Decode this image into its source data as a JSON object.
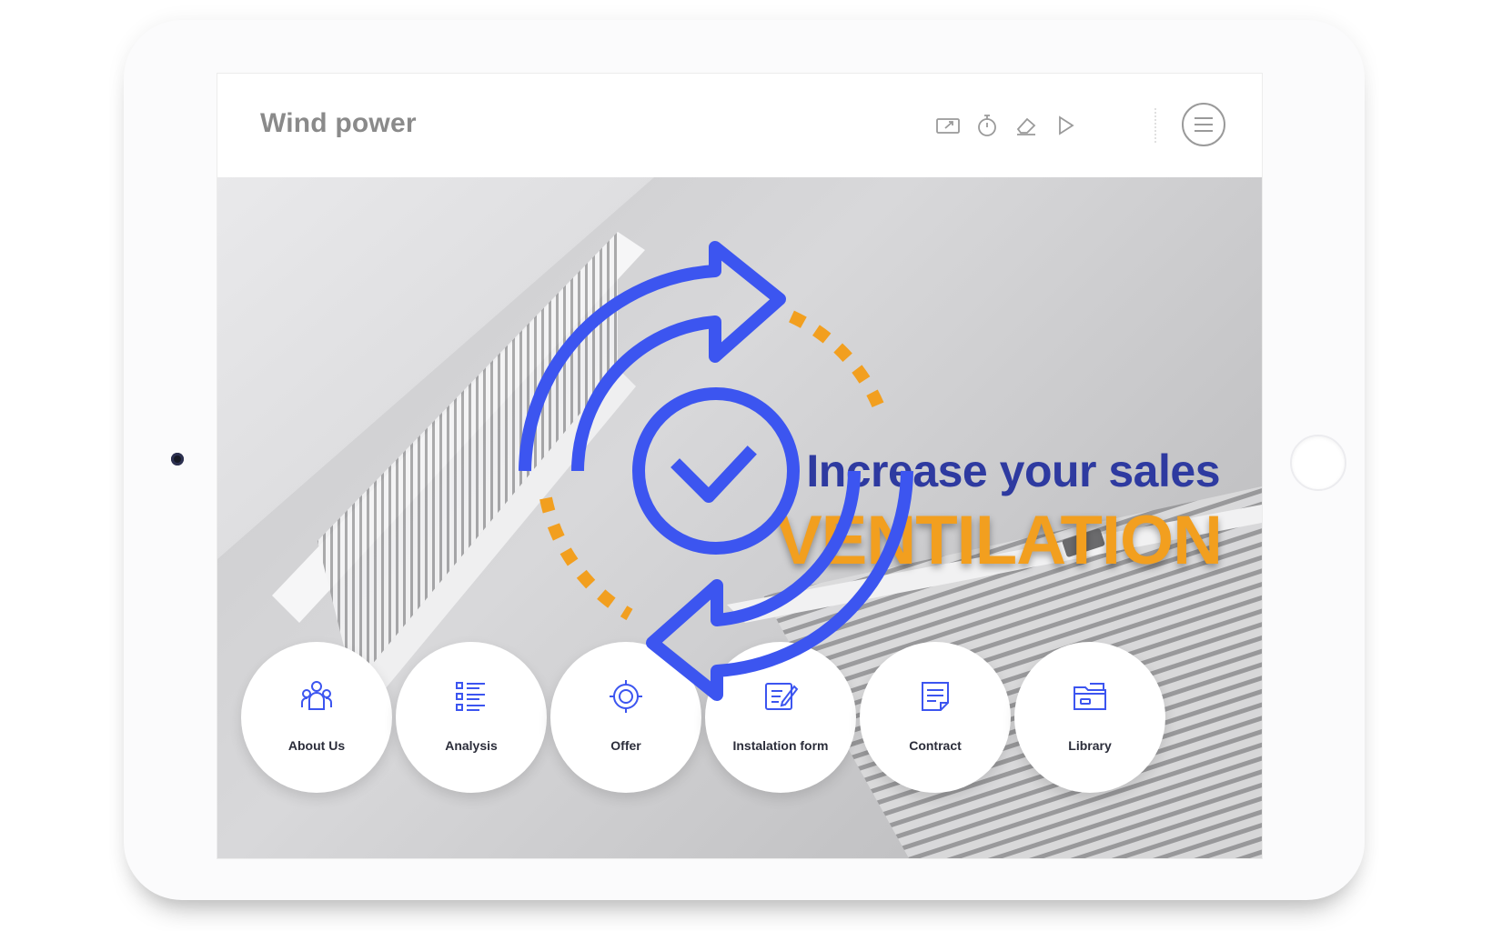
{
  "app": {
    "title": "Wind power"
  },
  "toolbar": {
    "icons": [
      "present-icon",
      "timer-icon",
      "eraser-icon",
      "play-icon"
    ],
    "menu_icon": "hamburger-menu-icon"
  },
  "hero": {
    "headline": "Increase your sales",
    "subheadline": "VENTILATION"
  },
  "nav": [
    {
      "label": "About Us",
      "icon": "team-icon"
    },
    {
      "label": "Analysis",
      "icon": "list-icon"
    },
    {
      "label": "Offer",
      "icon": "target-icon"
    },
    {
      "label": "Instalation form",
      "icon": "edit-form-icon"
    },
    {
      "label": "Contract",
      "icon": "document-icon"
    },
    {
      "label": "Library",
      "icon": "folder-icon"
    }
  ],
  "colors": {
    "accent_blue": "#3c55f0",
    "accent_orange": "#f29f1f",
    "headline_blue": "#2e3aa0",
    "title_gray": "#8a8a8a"
  }
}
